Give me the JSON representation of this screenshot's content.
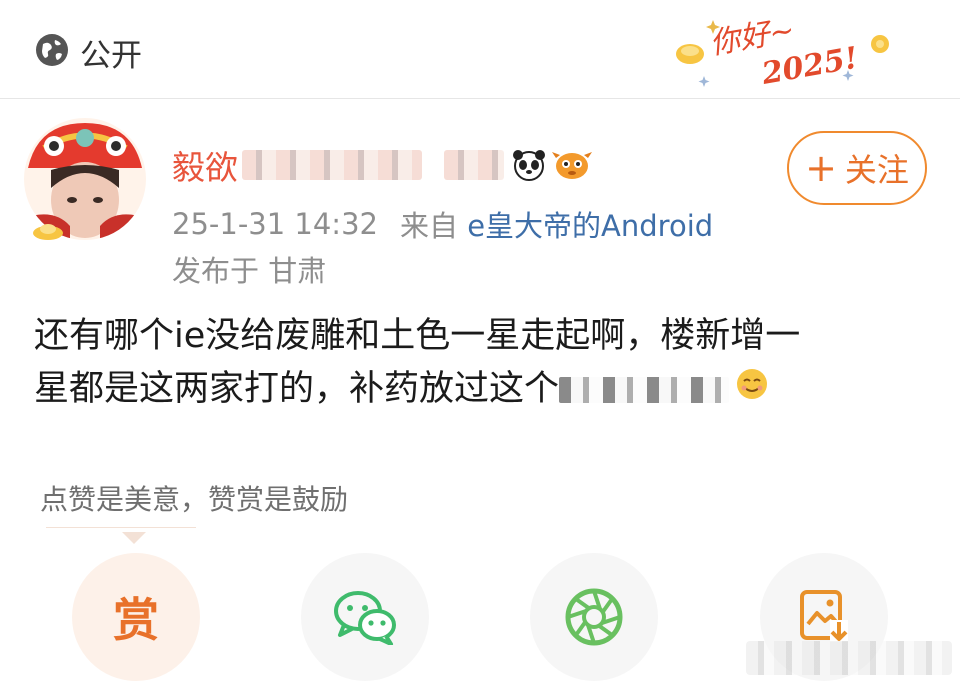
{
  "topbar": {
    "visibility_icon": "globe-icon",
    "visibility_label": "公开",
    "decoration_text": "你好~2025!"
  },
  "post": {
    "author": {
      "name": "毅欲",
      "avatar_icon": "lion-dance-avatar",
      "name_emojis": [
        "panda-emoji",
        "fish-emoji"
      ]
    },
    "follow_button": {
      "icon": "plus-icon",
      "label": "关注"
    },
    "time": "25-1-31 14:32",
    "source_prefix": "来自",
    "source": "e皇大帝的Android",
    "location": "发布于 甘肃",
    "content_line1": "还有哪个ie没给废雕和土色一星走起啊，楼新增一",
    "content_line2": "星都是这两家打的，补药放过这个"
  },
  "reward": {
    "hint": "点赞是美意，赞赏是鼓励",
    "reward_label": "赏"
  },
  "actions": [
    {
      "name": "reward-button",
      "icon": "reward-icon"
    },
    {
      "name": "wechat-share-button",
      "icon": "wechat-icon"
    },
    {
      "name": "moments-share-button",
      "icon": "moments-icon"
    },
    {
      "name": "save-image-button",
      "icon": "save-image-icon"
    }
  ],
  "colors": {
    "accent": "#e8712a",
    "username": "#e8553c",
    "source_link": "#3e6ea8",
    "wechat": "#3fbb6c",
    "moments": "#69c060",
    "secondary_text": "#8e8e8e"
  }
}
